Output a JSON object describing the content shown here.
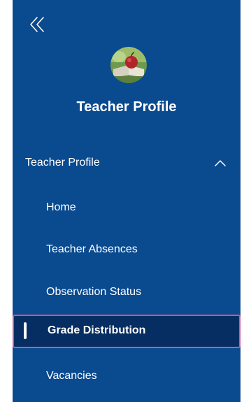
{
  "app": {
    "title": "Teacher Profile"
  },
  "sidebar": {
    "section": {
      "label": "Teacher Profile",
      "expanded": true
    },
    "items": [
      {
        "label": "Home",
        "active": false
      },
      {
        "label": "Teacher Absences",
        "active": false
      },
      {
        "label": "Observation Status",
        "active": false
      },
      {
        "label": "Grade Distribution",
        "active": true
      },
      {
        "label": "Vacancies",
        "active": false
      }
    ]
  },
  "icons": {
    "collapse": "double-chevron-left-icon",
    "section_toggle": "chevron-up-icon",
    "avatar": "apple-books-avatar"
  },
  "colors": {
    "sidebar_bg": "#0a4a8f",
    "active_bg": "#062e62",
    "active_border": "#d84f99",
    "text": "#ffffff"
  }
}
